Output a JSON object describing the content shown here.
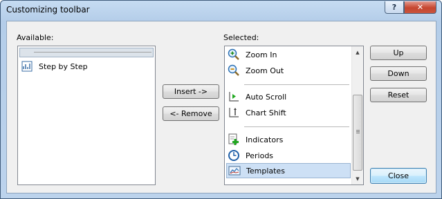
{
  "window": {
    "title": "Customizing toolbar",
    "help_label": "?",
    "close_label": "✕"
  },
  "available": {
    "label": "Available:",
    "items": [
      {
        "label": "Step by Step",
        "icon": "step-by-step-icon"
      }
    ]
  },
  "selected": {
    "label": "Selected:",
    "items": [
      {
        "label": "Zoom In",
        "icon": "zoom-in-icon"
      },
      {
        "label": "Zoom Out",
        "icon": "zoom-out-icon"
      },
      {
        "label": "Auto Scroll",
        "icon": "auto-scroll-icon"
      },
      {
        "label": "Chart Shift",
        "icon": "chart-shift-icon"
      },
      {
        "label": "Indicators",
        "icon": "indicators-icon"
      },
      {
        "label": "Periods",
        "icon": "periods-icon"
      },
      {
        "label": "Templates",
        "icon": "templates-icon",
        "selected": true
      }
    ]
  },
  "buttons": {
    "insert": "Insert ->",
    "remove": "<- Remove",
    "up": "Up",
    "down": "Down",
    "reset": "Reset",
    "close": "Close"
  },
  "colors": {
    "selection": "#cde0f5",
    "default_button_border": "#3c7fb1"
  }
}
